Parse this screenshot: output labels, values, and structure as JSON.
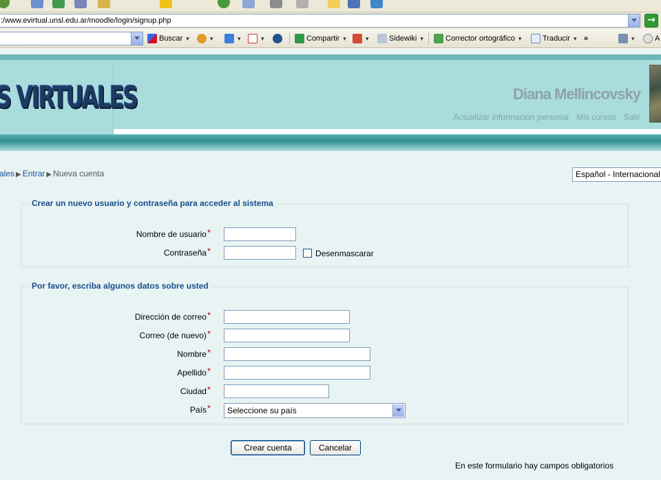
{
  "browser": {
    "address": ":/www.evirtual.unsl.edu.ar/moodle/login/signup.php",
    "go_label": "→",
    "toolbar": {
      "search_label": "Buscar",
      "share_label": "Compartir",
      "sidewiki_label": "Sidewiki",
      "spell_label": "Corrector ortográfico",
      "translate_label": "Traducir",
      "more_label": "»",
      "tail_label": "A"
    }
  },
  "header": {
    "logo_text": "S VIRTUALES",
    "user_name": "Diana Mellincovsky",
    "links": [
      "Actualizar información personal",
      "Mis cursos",
      "Salir"
    ]
  },
  "breadcrumb": {
    "items": [
      "ales",
      "Entrar",
      "Nueva cuenta"
    ]
  },
  "language": {
    "selected": "Español - Internacional"
  },
  "form": {
    "section1": {
      "legend": "Crear un nuevo usuario y contraseña para acceder al sistema",
      "username_label": "Nombre de usuario",
      "password_label": "Contraseña",
      "unmask_label": "Desenmascarar"
    },
    "section2": {
      "legend": "Por favor, escriba algunos datos sobre usted",
      "email_label": "Dirección de correo",
      "email2_label": "Correo (de nuevo)",
      "firstname_label": "Nombre",
      "lastname_label": "Apellido",
      "city_label": "Ciudad",
      "country_label": "País",
      "country_selected": "Seleccione su país"
    },
    "required_marker": "*",
    "submit_label": "Crear cuenta",
    "cancel_label": "Cancelar",
    "required_note": "En este formulario hay campos obligatorios"
  }
}
